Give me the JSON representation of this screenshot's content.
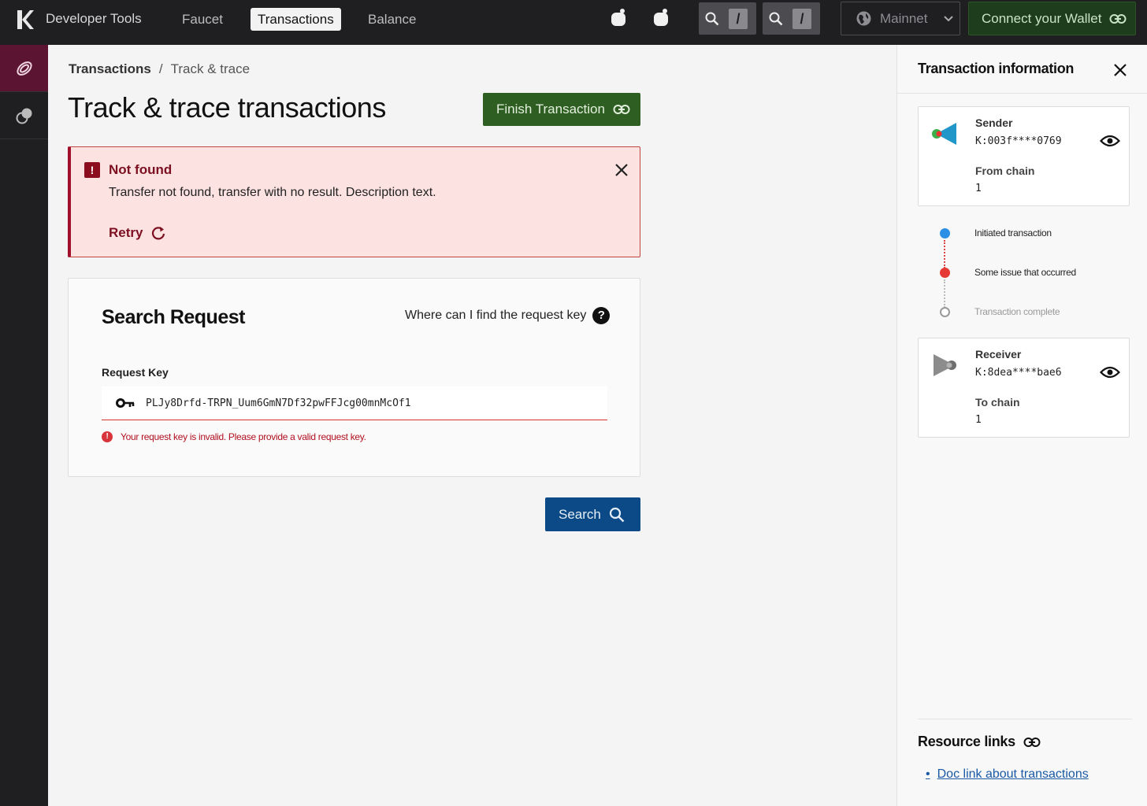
{
  "topnav": {
    "app_title": "Developer Tools",
    "links": [
      {
        "label": "Faucet"
      },
      {
        "label": "Transactions",
        "active": true
      },
      {
        "label": "Balance"
      }
    ],
    "search_slash": "/",
    "network": "Mainnet",
    "connect_label": "Connect your Wallet",
    "icons": [
      "kadena-logo-icon",
      "apple-icon",
      "apple-icon",
      "search-icon",
      "globe-icon",
      "chevron-down-icon",
      "link-icon"
    ]
  },
  "rail": {
    "items": [
      {
        "icon": "transactions-icon",
        "active": true
      },
      {
        "icon": "balance-icon",
        "active": false
      }
    ]
  },
  "breadcrumb": {
    "root": "Transactions",
    "separator": "/",
    "current": "Track & trace"
  },
  "page": {
    "title": "Track & trace transactions",
    "finish_label": "Finish Transaction"
  },
  "alert": {
    "icon_glyph": "!",
    "title": "Not found",
    "text": "Transfer not found, transfer with no result. Description text.",
    "retry_label": "Retry"
  },
  "search_card": {
    "title": "Search Request",
    "help_label": "Where can I find the request key",
    "help_glyph": "?",
    "field_label": "Request Key",
    "field_value": "PLJy8Drfd-TRPN_Uum6GmN7Df32pwFFJcg00mnMcOf1",
    "error_text": "Your request key is invalid. Please provide a valid request key.",
    "error_glyph": "!",
    "search_label": "Search"
  },
  "panel": {
    "title": "Transaction information",
    "sender": {
      "label": "Sender",
      "address": "K:003f****0769",
      "chain_label": "From chain",
      "chain_value": "1"
    },
    "steps": [
      {
        "label": "Initiated transaction",
        "status": "done",
        "color": "#2b8fe6"
      },
      {
        "label": "Some issue that occurred",
        "status": "error",
        "color": "#e53935"
      },
      {
        "label": "Transaction complete",
        "status": "pending",
        "color": "#999999"
      }
    ],
    "receiver": {
      "label": "Receiver",
      "address": "K:8dea****bae6",
      "chain_label": "To chain",
      "chain_value": "1"
    },
    "resources_title": "Resource links",
    "resource_links": [
      {
        "label": "Doc link about transactions"
      }
    ],
    "bullet": "•"
  },
  "colors": {
    "nav_bg": "#1f1f22",
    "rail_active": "#5c1433",
    "finish_green": "#2f5e22",
    "connect_green": "#1e3d1c",
    "search_blue": "#0b4a86",
    "alert_bg": "#fde2e2",
    "alert_red": "#7c1020"
  }
}
